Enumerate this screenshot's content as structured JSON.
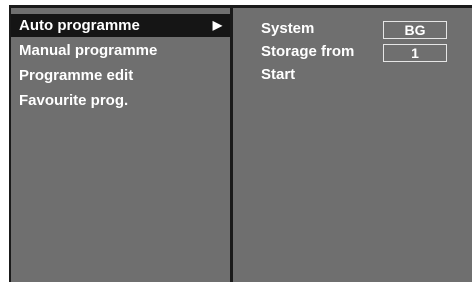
{
  "menu": {
    "items": [
      {
        "label": "Auto programme",
        "selected": true,
        "arrow": "▶"
      },
      {
        "label": "Manual programme"
      },
      {
        "label": "Programme edit"
      },
      {
        "label": "Favourite prog."
      }
    ]
  },
  "options": {
    "system": {
      "label": "System",
      "value": "BG"
    },
    "storage_from": {
      "label": "Storage from",
      "value": "1"
    },
    "start": {
      "label": "Start"
    }
  },
  "colors": {
    "panel": "#6f6f6f",
    "selection": "#151515",
    "frame": "#1a1a1a",
    "text": "#ffffff"
  }
}
